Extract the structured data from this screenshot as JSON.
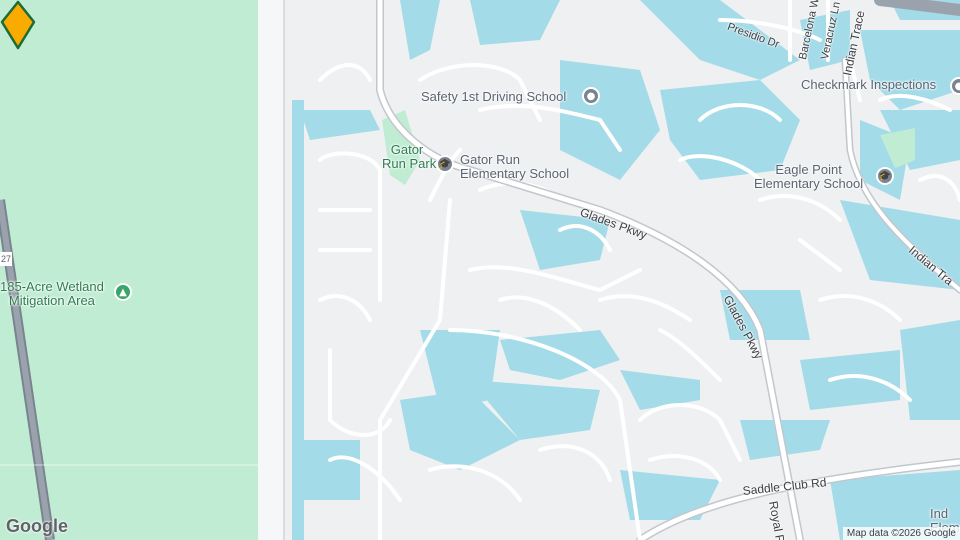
{
  "map": {
    "labels": {
      "safety_school": "Safety 1st Driving School",
      "gator_run_park": "Gator\nRun Park",
      "gator_run_elementary": "Gator Run\nElementary School",
      "checkmark": "Checkmark Inspections",
      "eagle_point": "Eagle Point\nElementary School",
      "wetland": "185-Acre Wetland\nMitigation Area",
      "glades_pkwy_1": "Glades Pkwy",
      "glades_pkwy_2": "Glades Pkwy",
      "saddle_club": "Saddle Club Rd",
      "royal_pa": "Royal P",
      "indian_trace_1": "Indian Trace",
      "indian_trace_2": "Indian Tra",
      "presidio": "Presidio Dr",
      "barcelona": "Barcelona W",
      "veracruz": "Veracruz Ln",
      "ind_elem": "Ind\nElemen",
      "route_shield": "27"
    },
    "icons": {
      "safety_school": "pin-icon",
      "gator_run_elementary": "school-cap-icon",
      "eagle_point": "school-cap-icon",
      "checkmark": "pin-icon",
      "wetland": "tree-icon",
      "marker": "selected-location-marker"
    },
    "colors": {
      "water": "#a4dbe8",
      "land": "#eef0f2",
      "park": "#c1ecd4",
      "road": "#ffffff",
      "major_road": "#c2c7cd",
      "marker_fill": "#f9ab00",
      "marker_stroke": "#1e6b35"
    },
    "attribution": "Map data ©2026 Google",
    "logo": "Google"
  }
}
